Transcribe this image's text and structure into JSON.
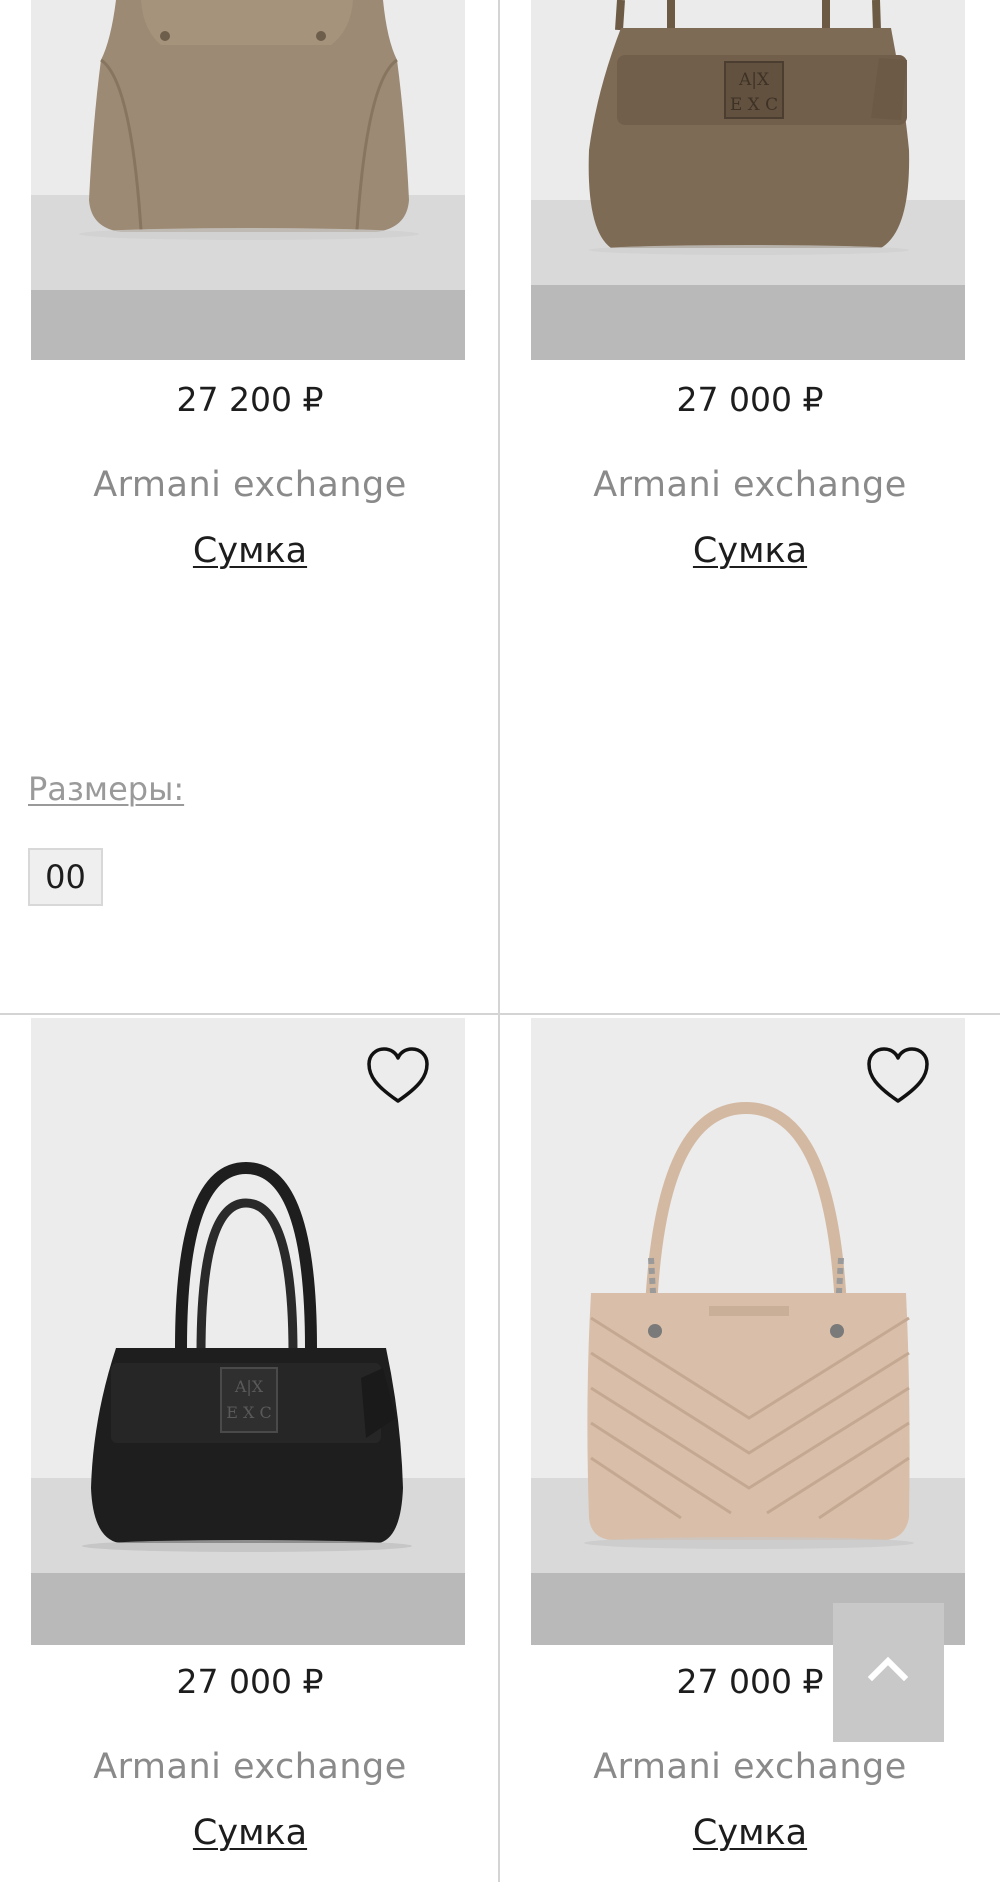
{
  "products": [
    {
      "price": "27 200 ₽",
      "brand": "Armani exchange",
      "name": "Сумка",
      "sizes_label": "Размеры:",
      "sizes": [
        "00"
      ]
    },
    {
      "price": "27 000 ₽",
      "brand": "Armani exchange",
      "name": "Сумка"
    },
    {
      "price": "27 000 ₽",
      "brand": "Armani exchange",
      "name": "Сумка"
    },
    {
      "price": "27 000 ₽",
      "brand": "Armani exchange",
      "name": "Сумка"
    }
  ],
  "icons": {
    "favorite": "heart-outline-icon",
    "scroll_top": "chevron-up-icon"
  },
  "colors": {
    "bag_taupe": "#9c8a74",
    "bag_brown": "#7e6b55",
    "bag_black": "#1e1e1e",
    "bag_beige": "#d9bfa9",
    "scroll_button": "#c8c8c8"
  }
}
